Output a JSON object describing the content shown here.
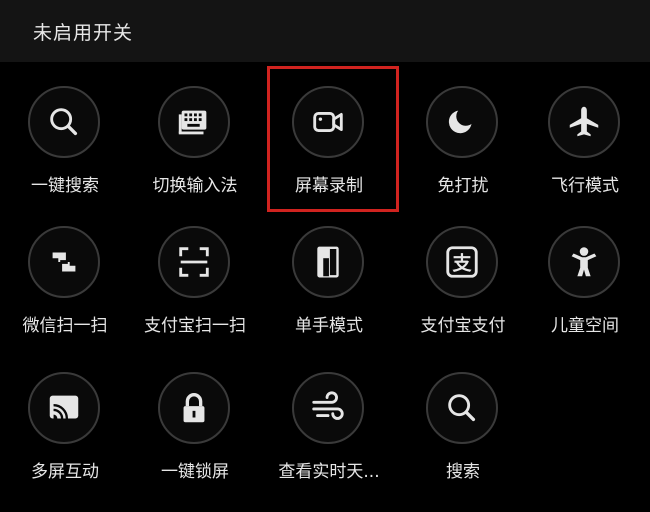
{
  "header": {
    "title": "未启用开关"
  },
  "tiles": [
    {
      "label": "一键搜索"
    },
    {
      "label": "切换输入法"
    },
    {
      "label": "屏幕录制"
    },
    {
      "label": "免打扰"
    },
    {
      "label": "飞行模式"
    },
    {
      "label": "微信扫一扫"
    },
    {
      "label": "支付宝扫一扫"
    },
    {
      "label": "单手模式"
    },
    {
      "label": "支付宝支付"
    },
    {
      "label": "儿童空间"
    },
    {
      "label": "多屏互动"
    },
    {
      "label": "一键锁屏"
    },
    {
      "label": "查看实时天..."
    },
    {
      "label": "搜索"
    }
  ],
  "alipay_glyph": "支",
  "colors": {
    "highlight": "#d0231f",
    "icon": "#e6e6e6",
    "ring": "#3a3a3a"
  },
  "icons": [
    "search-icon",
    "keyboard-icon",
    "video-camera-icon",
    "moon-icon",
    "airplane-icon",
    "wechat-scan-icon",
    "scan-frame-icon",
    "one-hand-icon",
    "alipay-icon",
    "child-icon",
    "cast-icon",
    "lock-icon",
    "weather-wind-icon",
    "search-icon"
  ]
}
